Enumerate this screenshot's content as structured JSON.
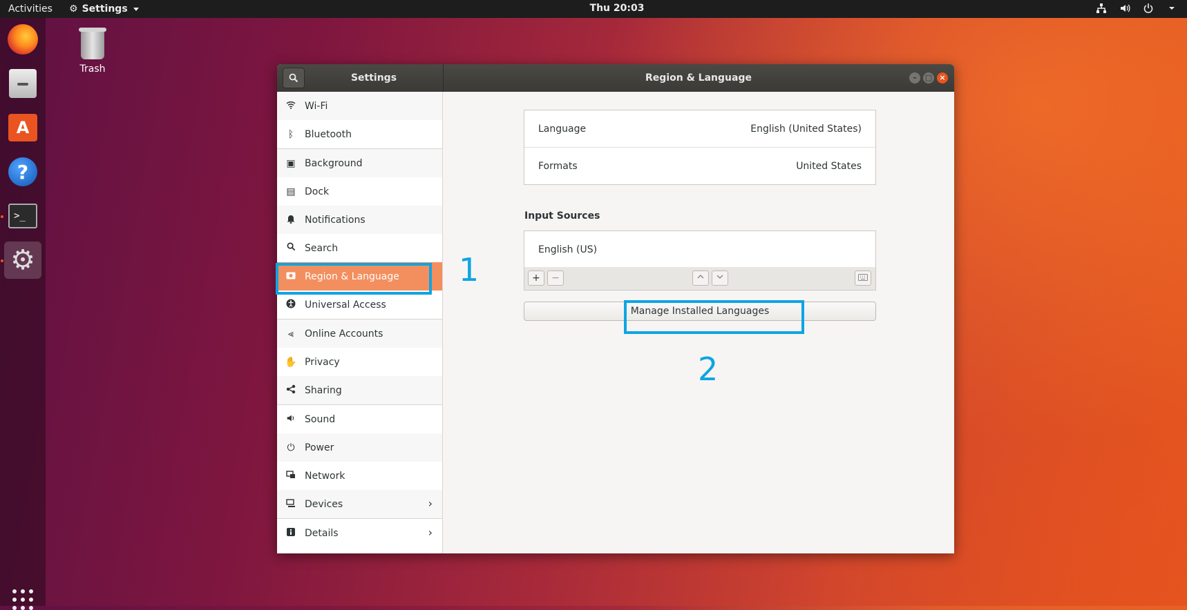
{
  "topbar": {
    "activities": "Activities",
    "app_menu": "Settings",
    "clock": "Thu 20:03"
  },
  "desktop": {
    "trash_label": "Trash"
  },
  "window": {
    "sidebar_title": "Settings",
    "page_title": "Region & Language"
  },
  "sidebar": {
    "items": [
      {
        "label": "Wi-Fi",
        "icon": "wifi-icon"
      },
      {
        "label": "Bluetooth",
        "icon": "bluetooth-icon"
      },
      {
        "label": "Background",
        "icon": "background-icon"
      },
      {
        "label": "Dock",
        "icon": "dock-icon"
      },
      {
        "label": "Notifications",
        "icon": "bell-icon"
      },
      {
        "label": "Search",
        "icon": "search-icon"
      },
      {
        "label": "Region & Language",
        "icon": "region-icon",
        "selected": true
      },
      {
        "label": "Universal Access",
        "icon": "accessibility-icon"
      },
      {
        "label": "Online Accounts",
        "icon": "online-accounts-icon"
      },
      {
        "label": "Privacy",
        "icon": "hand-icon"
      },
      {
        "label": "Sharing",
        "icon": "share-icon"
      },
      {
        "label": "Sound",
        "icon": "speaker-icon"
      },
      {
        "label": "Power",
        "icon": "power-plug-icon"
      },
      {
        "label": "Network",
        "icon": "network-icon"
      },
      {
        "label": "Devices",
        "icon": "devices-icon"
      },
      {
        "label": "Details",
        "icon": "info-icon"
      }
    ]
  },
  "region": {
    "language_label": "Language",
    "language_value": "English (United States)",
    "formats_label": "Formats",
    "formats_value": "United States",
    "input_sources_title": "Input Sources",
    "input_source_item": "English (US)",
    "add_label": "+",
    "remove_label": "−",
    "up_label": "⌃",
    "down_label": "⌄",
    "manage_button": "Manage Installed Languages"
  },
  "annotations": {
    "step1": "1",
    "step2": "2",
    "color": "#0ea5e3"
  },
  "colors": {
    "accent": "#e95420",
    "selected_row": "#f38f5e"
  }
}
